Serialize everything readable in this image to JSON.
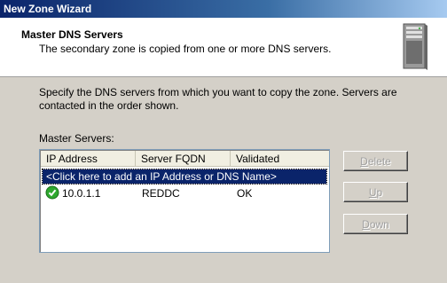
{
  "window": {
    "title": "New Zone Wizard"
  },
  "header": {
    "title": "Master DNS Servers",
    "subtitle": "The secondary zone is copied from one or more DNS servers."
  },
  "content": {
    "description": "Specify the DNS servers from which you want to copy the zone.  Servers are contacted in the order shown.",
    "master_label": "Master Servers:"
  },
  "list": {
    "columns": [
      "IP Address",
      "Server FQDN",
      "Validated"
    ],
    "add_placeholder": "<Click here to add an IP Address or DNS Name>",
    "rows": [
      {
        "ip": "10.0.1.1",
        "fqdn": "REDDC",
        "validated": "OK",
        "status_icon": "ok-check-icon"
      }
    ]
  },
  "buttons": {
    "delete_first": "D",
    "delete_rest": "elete",
    "up_first": "U",
    "up_rest": "p",
    "down_first": "D",
    "down_rest": "own"
  },
  "colors": {
    "selection": "#0a246a",
    "dialog_bg": "#d4d0c8",
    "ok_green": "#2ea82e"
  }
}
